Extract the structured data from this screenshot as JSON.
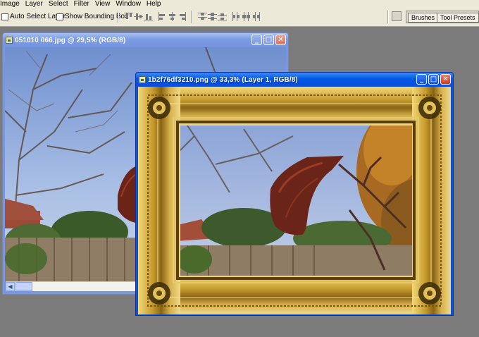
{
  "menu": [
    "Image",
    "Layer",
    "Select",
    "Filter",
    "View",
    "Window",
    "Help"
  ],
  "options": {
    "auto_select_layer": {
      "label": "Auto Select Layer",
      "checked": false
    },
    "show_bounding_box": {
      "label": "Show Bounding Box",
      "checked": false
    },
    "align_icons": [
      "align-top-edges-icon",
      "align-vertical-centers-icon",
      "align-bottom-edges-icon",
      "align-left-edges-icon",
      "align-horizontal-centers-icon",
      "align-right-edges-icon"
    ],
    "distribute_icons": [
      "distribute-top-icon",
      "distribute-vertical-centers-icon",
      "distribute-bottom-icon",
      "distribute-left-icon",
      "distribute-horizontal-centers-icon",
      "distribute-right-icon"
    ]
  },
  "palette_well": {
    "tabs": [
      "Brushes",
      "Tool Presets"
    ]
  },
  "documents": [
    {
      "title": "051010 066.jpg @ 29,5% (RGB/8)",
      "active": false,
      "scroll_position": 0.08
    },
    {
      "title": "1b2f76df3210.png @ 33,3% (Layer 1, RGB/8)",
      "active": true
    }
  ],
  "colors": {
    "workspace": "#7b7b7b",
    "chrome": "#ece9d8",
    "title_active": "#0058e6",
    "title_inactive": "#7b9be3"
  }
}
